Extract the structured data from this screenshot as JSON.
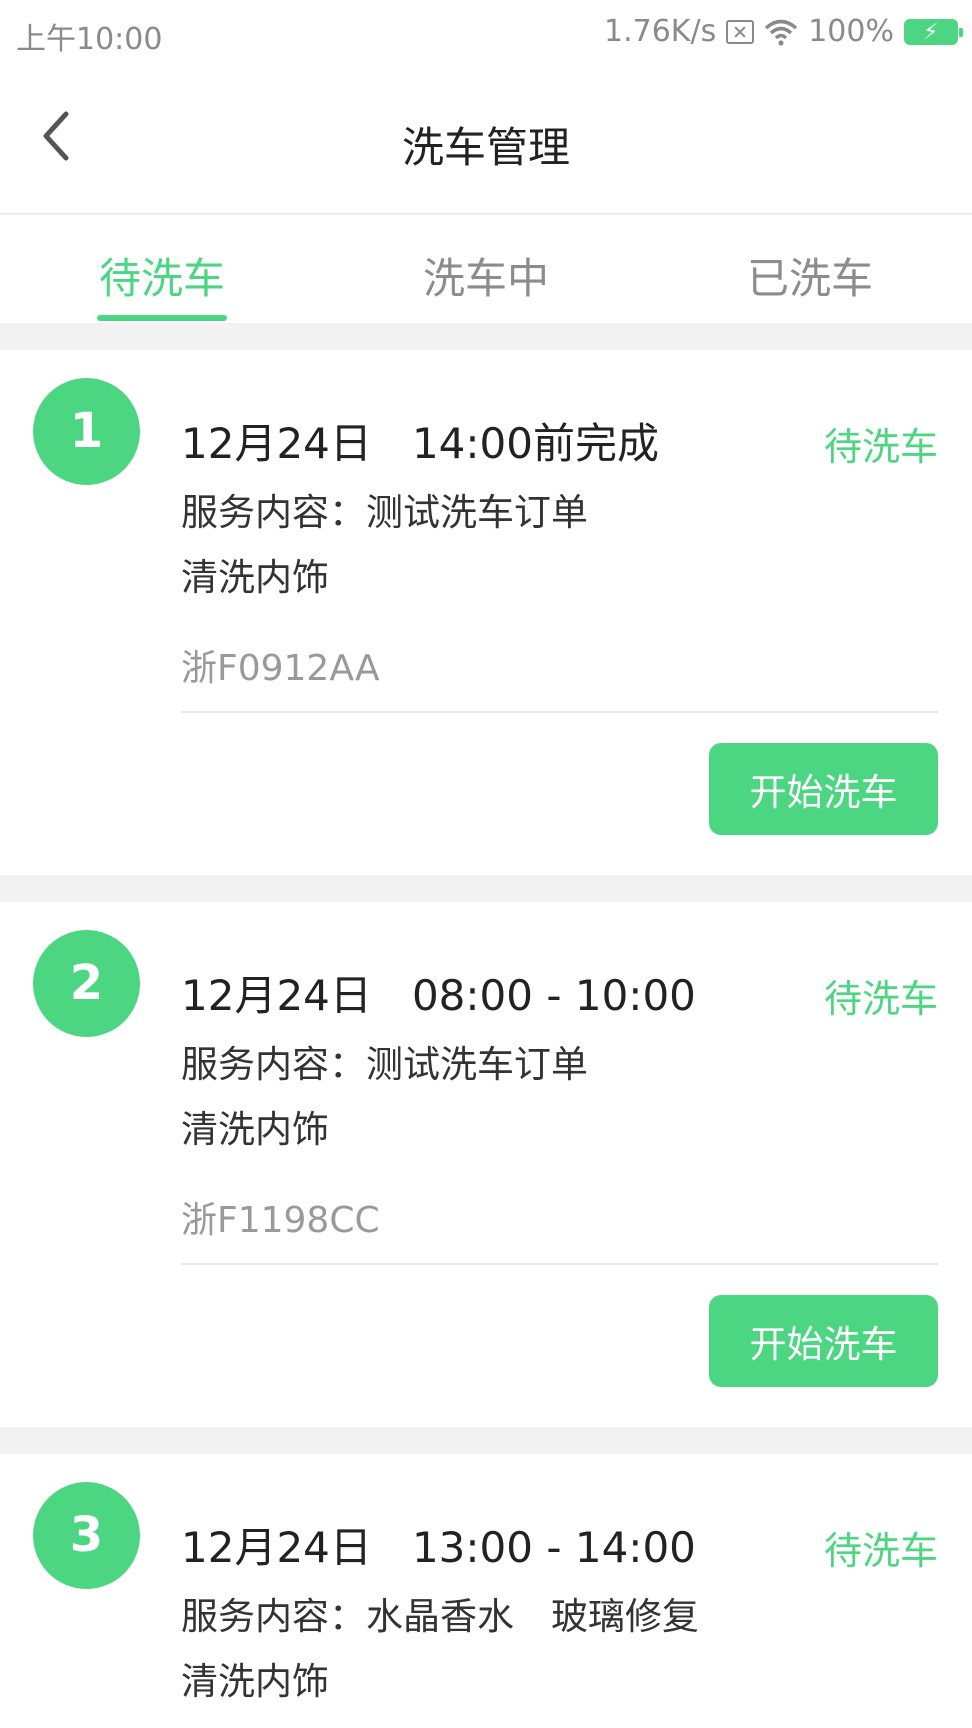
{
  "status_bar": {
    "time": "上午10:00",
    "network_speed": "1.76K/s",
    "battery": "100%",
    "icons": [
      "sim-off-icon",
      "wifi-icon",
      "battery-charging-icon"
    ]
  },
  "header": {
    "title": "洗车管理",
    "back_icon": "chevron-left-icon"
  },
  "tabs": [
    {
      "label": "待洗车",
      "active": true
    },
    {
      "label": "洗车中",
      "active": false
    },
    {
      "label": "已洗车",
      "active": false
    }
  ],
  "colors": {
    "accent": "#4cd682",
    "background": "#f2f2f2"
  },
  "orders": [
    {
      "number": "1",
      "date": "12月24日",
      "time": "14:00前完成",
      "status": "待洗车",
      "service": "服务内容：测试洗车订单",
      "extra": "清洗内饰",
      "plate": "浙F0912AA",
      "button": "开始洗车"
    },
    {
      "number": "2",
      "date": "12月24日",
      "time": "08:00 - 10:00",
      "status": "待洗车",
      "service": "服务内容：测试洗车订单",
      "extra": "清洗内饰",
      "plate": "浙F1198CC",
      "button": "开始洗车"
    },
    {
      "number": "3",
      "date": "12月24日",
      "time": "13:00 - 14:00",
      "status": "待洗车",
      "service": "服务内容：水晶香水　玻璃修复",
      "extra": "清洗内饰"
    }
  ]
}
